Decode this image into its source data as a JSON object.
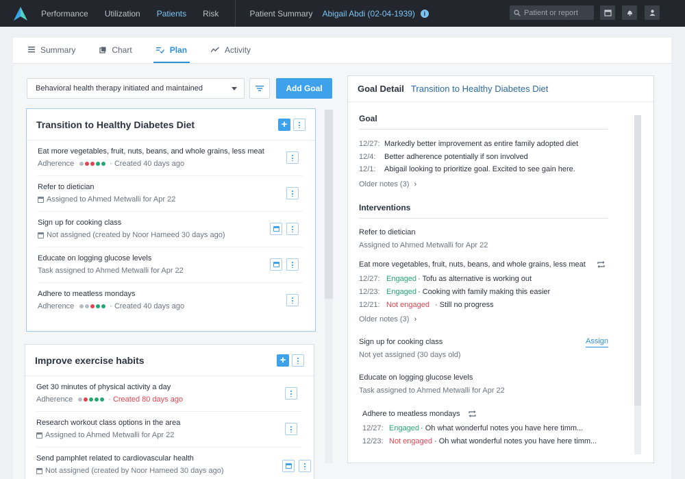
{
  "nav": {
    "items": [
      "Performance",
      "Utilization",
      "Patients",
      "Risk"
    ],
    "active": "Patients",
    "context_label": "Patient Summary",
    "patient": "Abigail Abdi (02-04-1939)",
    "info_glyph": "i",
    "search_placeholder": "Patient or report",
    "icons": [
      "logo-icon",
      "calendar-icon",
      "bell-icon",
      "user-icon"
    ]
  },
  "tabs": [
    {
      "label": "Summary",
      "icon": "list-icon"
    },
    {
      "label": "Chart",
      "icon": "chart-icon"
    },
    {
      "label": "Plan",
      "icon": "plan-icon",
      "active": true
    },
    {
      "label": "Activity",
      "icon": "activity-icon"
    }
  ],
  "plan": {
    "selected_filter": "Behavioral health therapy initiated and maintained",
    "add_goal": "Add Goal",
    "goals": [
      {
        "title": "Transition to Healthy Diabetes Diet",
        "tasks": [
          {
            "title": "Eat more vegetables, fruit, nuts, beans, and whole grains, less meat",
            "prefix": "Adherence",
            "sub": "· Created 40 days ago"
          },
          {
            "title": "Refer to dietician",
            "sub": "Assigned to Ahmed Metwalli for Apr 22"
          },
          {
            "title": "Sign up for cooking class",
            "sub": "Not assigned (created by Noor Hameed 30 days ago)"
          },
          {
            "title": "Educate on logging glucose levels",
            "sub": "Task assigned to Ahmed Metwalli for Apr 22"
          },
          {
            "title": "Adhere to meatless mondays",
            "prefix": "Adherence",
            "sub": "· Created 40 days ago"
          }
        ]
      },
      {
        "title": "Improve exercise habits",
        "tasks": [
          {
            "title": "Get 30 minutes of physical activity a day",
            "prefix": "Adherence",
            "sub": "· Created 80 days ago"
          },
          {
            "title": "Research workout class options in the area",
            "sub": "Assigned to Ahmed Metwalli for Apr 22"
          },
          {
            "title": "Send pamphlet related to cardiovascular health",
            "sub": "Not assigned (created by Noor Hameed 30 days ago)"
          }
        ]
      }
    ],
    "adherence_colors": {
      "grey": "#b5bcc4",
      "red": "#e0454f",
      "green": "#24a873"
    }
  },
  "detail": {
    "label": "Goal Detail",
    "title": "Transition to Healthy Diabetes Diet",
    "goal_section": "Goal",
    "goal_notes": [
      {
        "date": "12/27:",
        "text": "Markedly better improvement as entire family adopted diet"
      },
      {
        "date": "12/4:",
        "text": "Better adherence potentially if son involved"
      },
      {
        "date": "12/1:",
        "text": "Abigail looking to prioritize goal. Excited to see gain here."
      }
    ],
    "older_notes": "Older notes (3)",
    "interventions_section": "Interventions",
    "interventions": [
      {
        "title": "Refer to dietician",
        "sub": "Assigned to Ahmed Metwalli for Apr 22"
      },
      {
        "title": "Eat more vegetables, fruit, nuts, beans, and whole grains, less meat",
        "notes": [
          {
            "date": "12/27:",
            "status": "Engaged",
            "text": "· Tofu as alternative is working out"
          },
          {
            "date": "12/23:",
            "status": "Engaged",
            "text": "· Cooking with family making this easier"
          },
          {
            "date": "12/21:",
            "status": "Not engaged",
            "text": "· Still no progress"
          }
        ],
        "older": "Older notes (3)"
      },
      {
        "title": "Sign up for cooking class",
        "sub": "Not yet assigned (30 days old)",
        "action": "Assign"
      },
      {
        "title": "Educate on logging glucose levels",
        "sub": "Task assigned to Ahmed Metwalli for Apr 22"
      },
      {
        "title": "Adhere to meatless mondays",
        "notes": [
          {
            "date": "12/27:",
            "status": "Engaged",
            "text": "· Oh what wonderful notes you have here timm..."
          },
          {
            "date": "12/23:",
            "status": "Not engaged",
            "text": "· Oh what wonderful notes you have here timm..."
          }
        ]
      }
    ]
  }
}
